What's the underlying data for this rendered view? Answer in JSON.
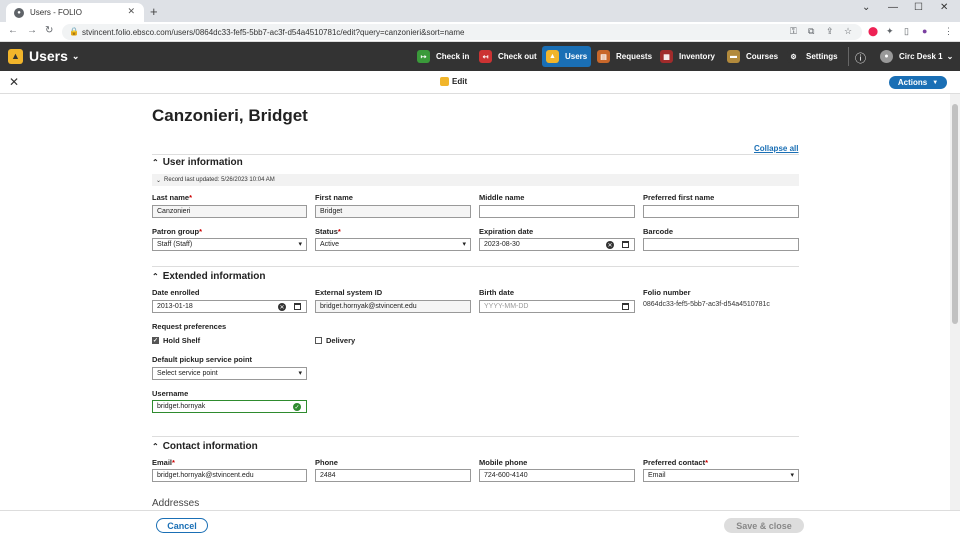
{
  "browser": {
    "tab_title": "Users - FOLIO",
    "url": "stvincent.folio.ebsco.com/users/0864dc33-fef5-5bb7-ac3f-d54a4510781c/edit?query=canzonieri&sort=name"
  },
  "app": {
    "name": "Users",
    "modules": [
      "Check in",
      "Check out",
      "Users",
      "Requests",
      "Inventory",
      "Courses",
      "Settings"
    ],
    "desk": "Circ Desk 1"
  },
  "paneheader": {
    "title": "Edit",
    "actions": "Actions"
  },
  "record": {
    "name": "Canzonieri, Bridget",
    "collapse_all": "Collapse all",
    "last_updated": "Record last updated: 5/26/2023 10:04 AM"
  },
  "sections": {
    "user": "User information",
    "extended": "Extended information",
    "contact": "Contact information",
    "addresses": "Addresses"
  },
  "user_info": {
    "last_name_label": "Last name",
    "last_name": "Canzonieri",
    "first_name_label": "First name",
    "first_name": "Bridget",
    "middle_name_label": "Middle name",
    "middle_name": "",
    "preferred_label": "Preferred first name",
    "preferred": "",
    "patron_group_label": "Patron group",
    "patron_group": "Staff (Staff)",
    "status_label": "Status",
    "status": "Active",
    "expiration_label": "Expiration date",
    "expiration": "2023-08-30",
    "barcode_label": "Barcode",
    "barcode": ""
  },
  "extended": {
    "enrolled_label": "Date enrolled",
    "enrolled": "2013-01-18",
    "ext_id_label": "External system ID",
    "ext_id": "bridget.hornyak@stvincent.edu",
    "birth_label": "Birth date",
    "birth_placeholder": "YYYY-MM-DD",
    "folio_label": "Folio number",
    "folio": "0864dc33-fef5-5bb7-ac3f-d54a4510781c",
    "request_pref_label": "Request preferences",
    "hold_shelf": "Hold Shelf",
    "delivery": "Delivery",
    "pickup_label": "Default pickup service point",
    "pickup": "Select service point",
    "username_label": "Username",
    "username": "bridget.hornyak"
  },
  "contact": {
    "email_label": "Email",
    "email": "bridget.hornyak@stvincent.edu",
    "phone_label": "Phone",
    "phone": "2484",
    "mobile_label": "Mobile phone",
    "mobile": "724-600-4140",
    "preferred_label": "Preferred contact",
    "preferred": "Email"
  },
  "footer": {
    "cancel": "Cancel",
    "save": "Save & close"
  }
}
